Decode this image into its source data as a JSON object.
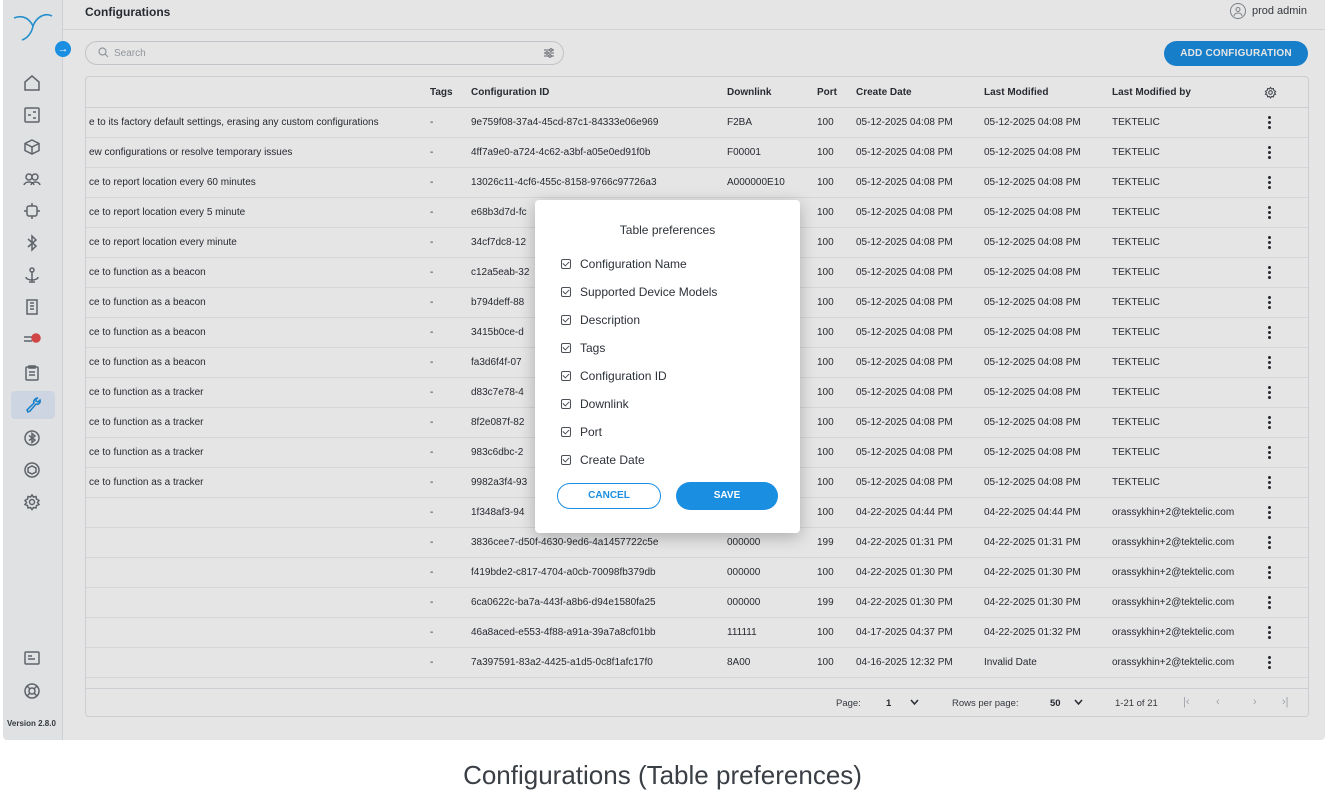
{
  "header": {
    "title": "Configurations",
    "user_name": "prod admin"
  },
  "search": {
    "placeholder": "Search"
  },
  "add_button": "ADD CONFIGURATION",
  "sidebar": {
    "version": "Version 2.8.0"
  },
  "columns": {
    "tags": "Tags",
    "configuration_id": "Configuration ID",
    "downlink": "Downlink",
    "port": "Port",
    "create_date": "Create Date",
    "last_modified": "Last Modified",
    "last_modified_by": "Last Modified by"
  },
  "rows": [
    {
      "desc": "e to its factory default settings, erasing any custom configurations",
      "tags": "-",
      "id": "9e759f08-37a4-45cd-87c1-84333e06e969",
      "downlink": "F2BA",
      "port": "100",
      "create": "05-12-2025 04:08 PM",
      "modified": "05-12-2025 04:08 PM",
      "by": "TEKTELIC"
    },
    {
      "desc": "ew configurations or resolve temporary issues",
      "tags": "-",
      "id": "4ff7a9e0-a724-4c62-a3bf-a05e0ed91f0b",
      "downlink": "F00001",
      "port": "100",
      "create": "05-12-2025 04:08 PM",
      "modified": "05-12-2025 04:08 PM",
      "by": "TEKTELIC"
    },
    {
      "desc": "ce to report location every 60 minutes",
      "tags": "-",
      "id": "13026c11-4cf6-455c-8158-9766c97726a3",
      "downlink": "A000000E10",
      "port": "100",
      "create": "05-12-2025 04:08 PM",
      "modified": "05-12-2025 04:08 PM",
      "by": "TEKTELIC"
    },
    {
      "desc": "ce to report location every 5 minute",
      "tags": "-",
      "id": "e68b3d7d-fc",
      "downlink": "",
      "port": "100",
      "create": "05-12-2025 04:08 PM",
      "modified": "05-12-2025 04:08 PM",
      "by": "TEKTELIC"
    },
    {
      "desc": "ce to report location every minute",
      "tags": "-",
      "id": "34cf7dc8-12",
      "downlink": "",
      "port": "100",
      "create": "05-12-2025 04:08 PM",
      "modified": "05-12-2025 04:08 PM",
      "by": "TEKTELIC"
    },
    {
      "desc": "ce to function as a beacon",
      "tags": "-",
      "id": "c12a5eab-32",
      "downlink": "",
      "port": "100",
      "create": "05-12-2025 04:08 PM",
      "modified": "05-12-2025 04:08 PM",
      "by": "TEKTELIC"
    },
    {
      "desc": "ce to function as a beacon",
      "tags": "-",
      "id": "b794deff-88",
      "downlink": "",
      "port": "100",
      "create": "05-12-2025 04:08 PM",
      "modified": "05-12-2025 04:08 PM",
      "by": "TEKTELIC"
    },
    {
      "desc": "ce to function as a beacon",
      "tags": "-",
      "id": "3415b0ce-d",
      "downlink": "",
      "port": "100",
      "create": "05-12-2025 04:08 PM",
      "modified": "05-12-2025 04:08 PM",
      "by": "TEKTELIC"
    },
    {
      "desc": "ce to function as a beacon",
      "tags": "-",
      "id": "fa3d6f4f-07",
      "downlink": "",
      "port": "100",
      "create": "05-12-2025 04:08 PM",
      "modified": "05-12-2025 04:08 PM",
      "by": "TEKTELIC"
    },
    {
      "desc": "ce to function as a tracker",
      "tags": "-",
      "id": "d83c7e78-4",
      "downlink": "",
      "port": "100",
      "create": "05-12-2025 04:08 PM",
      "modified": "05-12-2025 04:08 PM",
      "by": "TEKTELIC"
    },
    {
      "desc": "ce to function as a tracker",
      "tags": "-",
      "id": "8f2e087f-82",
      "downlink": "",
      "port": "100",
      "create": "05-12-2025 04:08 PM",
      "modified": "05-12-2025 04:08 PM",
      "by": "TEKTELIC"
    },
    {
      "desc": "ce to function as a tracker",
      "tags": "-",
      "id": "983c6dbc-2",
      "downlink": "",
      "port": "100",
      "create": "05-12-2025 04:08 PM",
      "modified": "05-12-2025 04:08 PM",
      "by": "TEKTELIC"
    },
    {
      "desc": "ce to function as a tracker",
      "tags": "-",
      "id": "9982a3f4-93",
      "downlink": "",
      "port": "100",
      "create": "05-12-2025 04:08 PM",
      "modified": "05-12-2025 04:08 PM",
      "by": "TEKTELIC"
    },
    {
      "desc": "",
      "tags": "-",
      "id": "1f348af3-94",
      "downlink": "",
      "port": "100",
      "create": "04-22-2025 04:44 PM",
      "modified": "04-22-2025 04:44 PM",
      "by": "orassykhin+2@tektelic.com"
    },
    {
      "desc": "",
      "tags": "-",
      "id": "3836cee7-d50f-4630-9ed6-4a1457722c5e",
      "downlink": "000000",
      "port": "199",
      "create": "04-22-2025 01:31 PM",
      "modified": "04-22-2025 01:31 PM",
      "by": "orassykhin+2@tektelic.com"
    },
    {
      "desc": "",
      "tags": "-",
      "id": "f419bde2-c817-4704-a0cb-70098fb379db",
      "downlink": "000000",
      "port": "100",
      "create": "04-22-2025 01:30 PM",
      "modified": "04-22-2025 01:30 PM",
      "by": "orassykhin+2@tektelic.com"
    },
    {
      "desc": "",
      "tags": "-",
      "id": "6ca0622c-ba7a-443f-a8b6-d94e1580fa25",
      "downlink": "000000",
      "port": "199",
      "create": "04-22-2025 01:30 PM",
      "modified": "04-22-2025 01:30 PM",
      "by": "orassykhin+2@tektelic.com"
    },
    {
      "desc": "",
      "tags": "-",
      "id": "46a8aced-e553-4f88-a91a-39a7a8cf01bb",
      "downlink": "111111",
      "port": "100",
      "create": "04-17-2025 04:37 PM",
      "modified": "04-22-2025 01:32 PM",
      "by": "orassykhin+2@tektelic.com"
    },
    {
      "desc": "",
      "tags": "-",
      "id": "7a397591-83a2-4425-a1d5-0c8f1afc17f0",
      "downlink": "8A00",
      "port": "100",
      "create": "04-16-2025 12:32 PM",
      "modified": "Invalid Date",
      "by": "orassykhin+2@tektelic.com"
    }
  ],
  "pagination": {
    "page_label": "Page:",
    "page_value": "1",
    "rows_label": "Rows per page:",
    "rows_value": "50",
    "range": "1-21 of 21"
  },
  "modal": {
    "title": "Table preferences",
    "options": [
      "Configuration Name",
      "Supported Device Models",
      "Description",
      "Tags",
      "Configuration ID",
      "Downlink",
      "Port",
      "Create Date"
    ],
    "cancel": "CANCEL",
    "save": "SAVE"
  },
  "caption": "Configurations (Table preferences)",
  "colors": {
    "accent": "#1a8ee0",
    "badge": "#e84d4d"
  }
}
